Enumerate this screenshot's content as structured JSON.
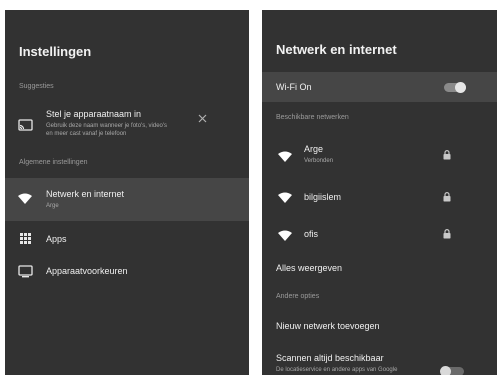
{
  "left": {
    "title": "Instellingen",
    "suggestions_header": "Suggesties",
    "suggestion": {
      "title": "Stel je apparaatnaam in",
      "desc_line1": "Gebruik deze naam wanneer je foto's, video's",
      "desc_line2": "en meer cast vanaf je telefoon",
      "icon": "cast-icon",
      "dismiss_icon": "close-icon"
    },
    "general_header": "Algemene instellingen",
    "items": [
      {
        "label": "Netwerk en internet",
        "sub": "Arge",
        "icon": "wifi-icon",
        "selected": true
      },
      {
        "label": "Apps",
        "icon": "apps-grid-icon"
      },
      {
        "label": "Apparaatvoorkeuren",
        "icon": "tv-icon"
      }
    ]
  },
  "right": {
    "title": "Netwerk en internet",
    "wifi_label": "Wi-Fi On",
    "wifi_on": true,
    "available_header": "Beschikbare netwerken",
    "networks": [
      {
        "name": "Arge",
        "status": "Verbonden",
        "icon": "wifi-icon",
        "lock_icon": "lock-icon"
      },
      {
        "name": "bilgiislem",
        "icon": "wifi-icon",
        "lock_icon": "lock-icon"
      },
      {
        "name": "ofis",
        "icon": "wifi-icon",
        "lock_icon": "lock-icon"
      }
    ],
    "see_all": "Alles weergeven",
    "other_header": "Andere opties",
    "add_network": "Nieuw netwerk toevoegen",
    "scan_title": "Scannen altijd beschikbaar",
    "scan_desc": "De locatieservice en andere apps van Google",
    "scan_on": false
  }
}
